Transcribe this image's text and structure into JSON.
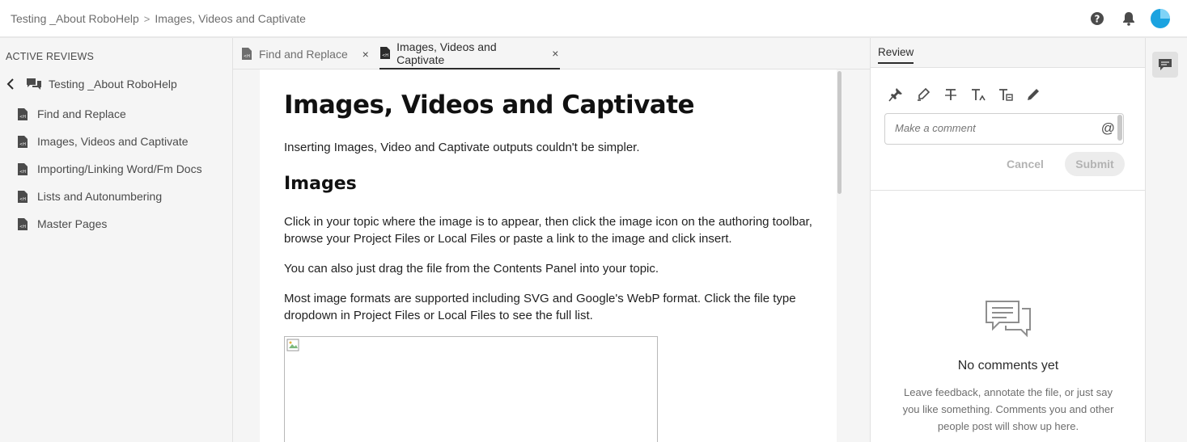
{
  "header": {
    "breadcrumb": [
      "Testing _About RoboHelp",
      "Images, Videos and Captivate"
    ],
    "breadcrumb_separator": ">",
    "icons": [
      "help-icon",
      "notification-bell-icon",
      "avatar"
    ],
    "avatar_color": "#1ba3e0"
  },
  "sidebar": {
    "heading": "ACTIVE REVIEWS",
    "review_title": "Testing _About RoboHelp",
    "topics": [
      {
        "label": "Find and Replace"
      },
      {
        "label": "Images, Videos and Captivate"
      },
      {
        "label": "Importing/Linking Word/Fm Docs"
      },
      {
        "label": "Lists and Autonumbering"
      },
      {
        "label": "Master Pages"
      }
    ]
  },
  "tabs": [
    {
      "label": "Find and Replace",
      "close": "×",
      "active": false
    },
    {
      "label": "Images, Videos and Captivate",
      "close": "×",
      "active": true
    }
  ],
  "document": {
    "title": "Images, Videos and Captivate",
    "intro": "Inserting Images, Video and Captivate outputs couldn't be simpler.",
    "section_heading": "Images",
    "paragraphs": [
      "Click in your topic where the image is to appear, then click the image icon on the authoring toolbar, browse your Project Files or Local Files or paste a link to the image and click insert.",
      "You can also just drag the file from the Contents Panel into your topic.",
      "Most image formats are supported including SVG and Google's WebP format. Click the file type dropdown in Project Files or Local Files to see the full list."
    ]
  },
  "review_panel": {
    "tab_label": "Review",
    "tools": [
      "pin-icon",
      "highlight-icon",
      "strikethrough-icon",
      "insert-text-icon",
      "replace-text-icon",
      "pencil-icon"
    ],
    "comment_placeholder": "Make a comment",
    "mention_symbol": "@",
    "cancel_label": "Cancel",
    "submit_label": "Submit",
    "empty_title": "No comments yet",
    "empty_description": "Leave feedback, annotate the file, or just say you like something. Comments you and other people post will show up here."
  },
  "rail": {
    "icons": [
      "comments-icon"
    ]
  }
}
